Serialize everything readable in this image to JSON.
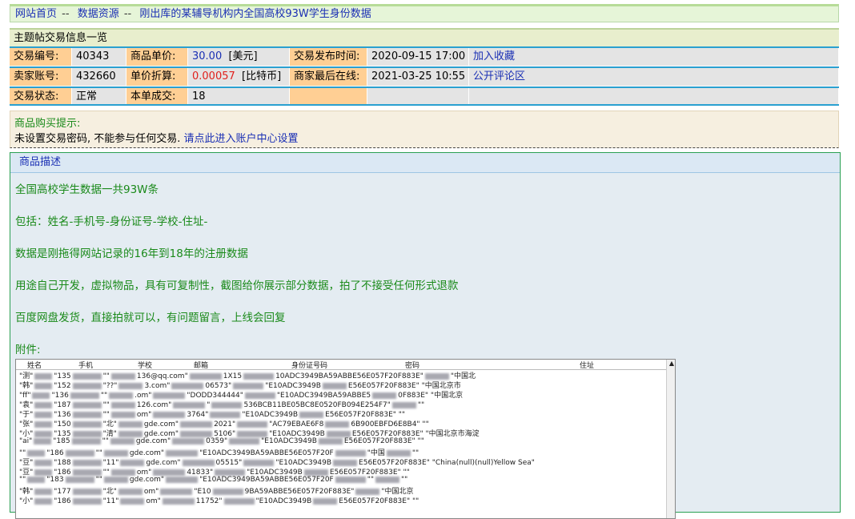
{
  "breadcrumb": {
    "home": "网站首页",
    "sep": "--",
    "resources": "数据资源",
    "current": "刚出库的某辅导机构内全国高校93W学生身份数据"
  },
  "info": {
    "title": "主题帖交易信息一览",
    "row1": {
      "l1": "交易编号:",
      "v1": "40343",
      "l2": "商品单价:",
      "v2": "30.00",
      "v2unit": "[美元]",
      "l3": "交易发布时间:",
      "v3": "2020-09-15 17:00",
      "link": "加入收藏"
    },
    "row2": {
      "l1": "卖家账号:",
      "v1": "432660",
      "l2": "单价折算:",
      "v2": "0.00057",
      "v2unit": "[比特币]",
      "l3": "商家最后在线:",
      "v3": "2021-03-25 10:55",
      "link": "公开评论区"
    },
    "row3": {
      "l1": "交易状态:",
      "v1": "正常",
      "l2": "本单成交:",
      "v2": "18"
    }
  },
  "tip": {
    "title": "商品购买提示:",
    "text": "未设置交易密码, 不能参与任何交易.",
    "link": "请点此进入账户中心设置"
  },
  "description": {
    "title": "商品描述",
    "lines": [
      "全国高校学生数据一共93W条",
      "包括：姓名-手机号-身份证号-学校-住址-",
      "数据是刚拖得网站记录的16年到18年的注册数据",
      "用途自己开发，虚拟物品，具有可复制性，截图给你展示部分数据，拍了不接受任何形式退款",
      "百度网盘发货，直接拍就可以，有问题留言，上线会回复",
      "附件:"
    ]
  },
  "attachment": {
    "columns": [
      "姓名",
      "手机",
      "学校",
      "邮箱",
      "身份证号码",
      "密码",
      "住址"
    ],
    "rows": [
      [
        "\"测\"",
        "\"135",
        "\"\"",
        "136@qq.com\"",
        "1X15",
        "10ADC3949BA59ABBE56E057F20F883E\"",
        "\"中国北"
      ],
      [
        "\"韩\"",
        "\"152",
        "\"??\"",
        "3.com\"",
        "06573\"",
        "\"E10ADC3949B",
        "E56E057F20F883E\" \"中国北京市"
      ],
      [
        "\"ff\"",
        "\"136",
        "\"\"",
        ".om\"",
        "\"DODD344444\"",
        "\"E10ADC3949BA59ABBE5",
        "0F883E\" \"中国北京"
      ],
      [
        "\"袁\"",
        "\"187",
        "\"\"",
        "126.com\"",
        "\"",
        "536BCB11BE05BC8E0520FB094E254F7\"",
        "\"\""
      ],
      [
        "\"于\"",
        "\"136",
        "\"\"",
        "om\"",
        "3764\"",
        "\"E10ADC3949B",
        "E56E057F20F883E\" \"\""
      ],
      [
        "\"张\"",
        "\"150",
        "\"北\"",
        "gde.com\"",
        "2021\"",
        "\"AC79EBAE6F8",
        "6B900EBFD6E8B4\" \"\""
      ],
      [
        "\"小\"",
        "\"135",
        "\"清\"",
        "gde.com\"",
        "5106\"",
        "\"E10ADC3949B",
        "E56E057F20F883E\" \"中国北京市海淀"
      ],
      [
        "\"ai\"",
        "\"185",
        "\"\"",
        "gde.com\"",
        "0359\"",
        "\"E10ADC3949B",
        "E56E057F20F883E\" \"\""
      ],
      [
        "\"\"",
        "\"186",
        "\"\"",
        "gde.com\"",
        "\"E10ADC3949BA59ABBE56E057F20F",
        "\"中国",
        "\"\""
      ],
      [
        "\"豆\"",
        "\"188",
        "\"11\"",
        "gde.com\"",
        "05515\"",
        "\"E10ADC3949B",
        "E56E057F20F883E\" \"China(null)(null)Yellow Sea\""
      ],
      [
        "\"豆\"",
        "\"186",
        "\"\"",
        "om\"",
        "41833\"",
        "\"E10ADC3949B",
        "E56E057F20F883E\" \"\""
      ],
      [
        "\"\"",
        "\"183",
        "\"\"",
        "gde.com\"",
        "\"E10ADC3949BA59ABBE56E057F20F",
        "\"\"",
        "\"\""
      ],
      [
        "\"韩\"",
        "\"177",
        "\"北\"",
        "om\"",
        "\"E10",
        "9BA59ABBE56E057F20F883E\"",
        "\"中国北京"
      ],
      [
        "\"小\"",
        "\"186",
        "\"11\"",
        "om\"",
        "11752\"",
        "\"E10ADC3949B",
        "E56E057F20F883E\" \"\""
      ]
    ]
  }
}
